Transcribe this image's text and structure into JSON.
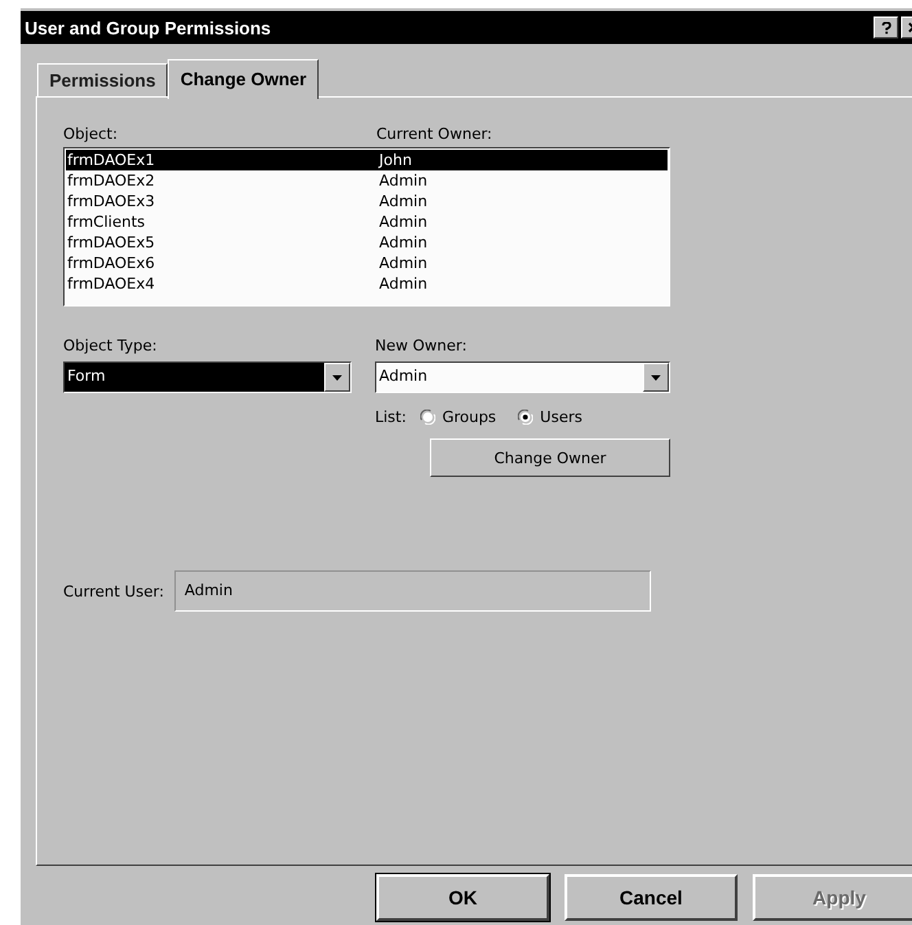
{
  "window": {
    "title": "User and Group Permissions"
  },
  "tabs": [
    {
      "label": "Permissions",
      "selected": false
    },
    {
      "label": "Change Owner",
      "selected": true
    }
  ],
  "object_list": {
    "columns": [
      "Object:",
      "Current Owner:"
    ],
    "rows": [
      {
        "object": "frmDAOEx1",
        "owner": "John",
        "selected": true
      },
      {
        "object": "frmDAOEx2",
        "owner": "Admin",
        "selected": false
      },
      {
        "object": "frmDAOEx3",
        "owner": "Admin",
        "selected": false
      },
      {
        "object": "frmClients",
        "owner": "Admin",
        "selected": false
      },
      {
        "object": "frmDAOEx5",
        "owner": "Admin",
        "selected": false
      },
      {
        "object": "frmDAOEx6",
        "owner": "Admin",
        "selected": false
      },
      {
        "object": "frmDAOEx4",
        "owner": "Admin",
        "selected": false
      }
    ]
  },
  "object_type": {
    "label": "Object Type:",
    "value": "Form"
  },
  "new_owner": {
    "label": "New Owner:",
    "value": "Admin"
  },
  "list_option": {
    "label": "List:",
    "options": [
      {
        "label": "Groups",
        "selected": false
      },
      {
        "label": "Users",
        "selected": true
      }
    ]
  },
  "change_owner_button": "Change Owner",
  "current_user": {
    "label": "Current User:",
    "value": "Admin"
  },
  "buttons": [
    {
      "label": "OK",
      "disabled": false,
      "default": true
    },
    {
      "label": "Cancel",
      "disabled": false,
      "default": false
    },
    {
      "label": "Apply",
      "disabled": true,
      "default": false
    }
  ]
}
